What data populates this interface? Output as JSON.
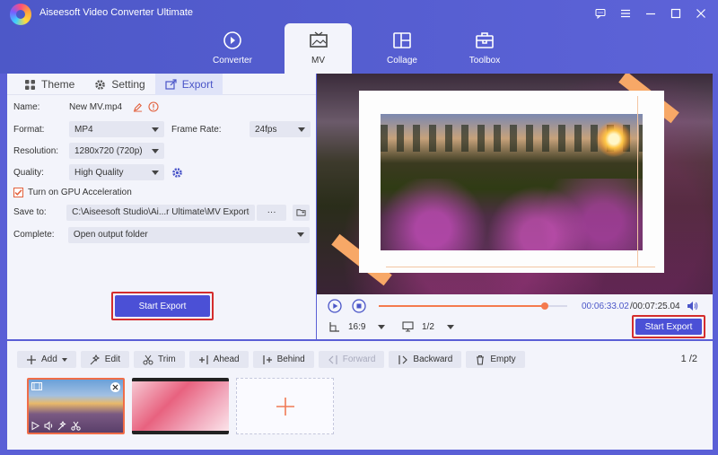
{
  "app": {
    "title": "Aiseesoft Video Converter Ultimate"
  },
  "nav": {
    "tabs": [
      {
        "label": "Converter",
        "icon": "converter-icon"
      },
      {
        "label": "MV",
        "icon": "mv-icon"
      },
      {
        "label": "Collage",
        "icon": "collage-icon"
      },
      {
        "label": "Toolbox",
        "icon": "toolbox-icon"
      }
    ],
    "active": "MV"
  },
  "left": {
    "tabs": [
      "Theme",
      "Setting",
      "Export"
    ],
    "active_tab": "Export",
    "name_label": "Name:",
    "name_value": "New MV.mp4",
    "format_label": "Format:",
    "format_value": "MP4",
    "frame_rate_label": "Frame Rate:",
    "frame_rate_value": "24fps",
    "resolution_label": "Resolution:",
    "resolution_value": "1280x720 (720p)",
    "quality_label": "Quality:",
    "quality_value": "High Quality",
    "gpu_label": "Turn on GPU Acceleration",
    "gpu_checked": true,
    "save_label": "Save to:",
    "save_value": "C:\\Aiseesoft Studio\\Ai...r Ultimate\\MV Exported",
    "browse_label": "···",
    "complete_label": "Complete:",
    "complete_value": "Open output folder",
    "start_export": "Start Export"
  },
  "player": {
    "current_time": "00:06:33.02",
    "total_time": "/00:07:25.04",
    "progress": 0.88,
    "aspect": "16:9",
    "screen": "1/2",
    "start_export": "Start Export"
  },
  "timeline": {
    "buttons": [
      {
        "label": "Add",
        "icon": "plus-icon",
        "disabled": false
      },
      {
        "label": "Edit",
        "icon": "magic-wand-icon",
        "disabled": false
      },
      {
        "label": "Trim",
        "icon": "scissors-icon",
        "disabled": false
      },
      {
        "label": "Ahead",
        "icon": "insert-ahead-icon",
        "disabled": false
      },
      {
        "label": "Behind",
        "icon": "insert-behind-icon",
        "disabled": false
      },
      {
        "label": "Forward",
        "icon": "move-forward-icon",
        "disabled": true
      },
      {
        "label": "Backward",
        "icon": "move-backward-icon",
        "disabled": false
      },
      {
        "label": "Empty",
        "icon": "trash-icon",
        "disabled": false
      }
    ],
    "page_indicator": "1 /2"
  },
  "colors": {
    "accent": "#4b50d6",
    "highlight": "#d42d2d",
    "progress": "#f47a4e",
    "header": "#5158cc"
  }
}
